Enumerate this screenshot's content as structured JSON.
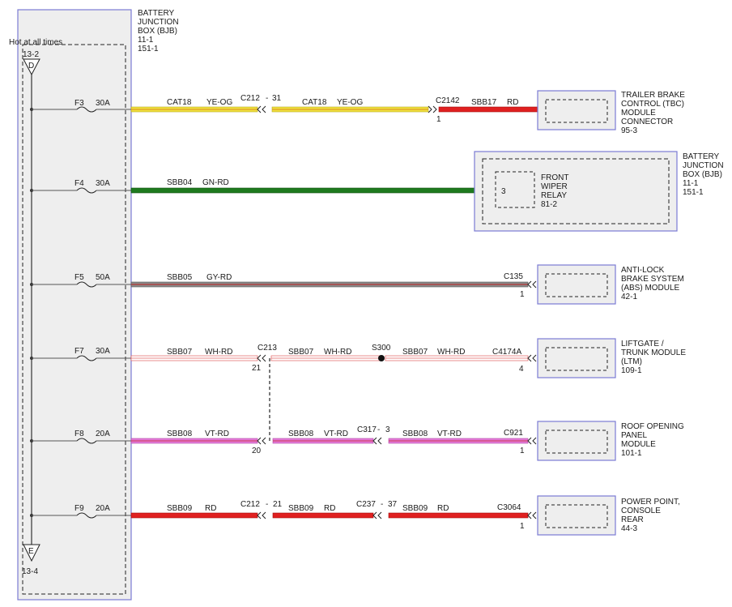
{
  "bjb_left": {
    "lines": [
      "BATTERY",
      "JUNCTION",
      "BOX (BJB)",
      "11-1",
      "151-1"
    ]
  },
  "hot_label": "Hot at all times",
  "top_connector": {
    "ref": "13-2",
    "letter": "D"
  },
  "bottom_connector": {
    "ref": "13-4",
    "letter": "E"
  },
  "circuits": [
    {
      "fuse": "F3",
      "amps": "30A",
      "segments": [
        {
          "circuit": "CAT18",
          "color": "YE-OG",
          "fill": "#f0e03c",
          "stripe": "#d98a24"
        },
        {
          "circuit": "CAT18",
          "color": "YE-OG",
          "fill": "#f0e03c",
          "stripe": "#d98a24"
        },
        {
          "circuit": "SBB17",
          "color": "RD",
          "fill": "#e02020",
          "stripe": ""
        }
      ],
      "breaks": [
        {
          "name": "C212",
          "sep": "-",
          "pin": "31"
        }
      ],
      "end_connector": "C2142",
      "end_pin": "1",
      "module": [
        "TRAILER BRAKE",
        "CONTROL (TBC)",
        "MODULE",
        "CONNECTOR",
        "95-3"
      ]
    },
    {
      "fuse": "F4",
      "amps": "30A",
      "segments": [
        {
          "circuit": "SBB04",
          "color": "GN-RD",
          "fill": "#1e7a1e",
          "stripe": "#c02020"
        }
      ],
      "relay": {
        "lines": [
          "FRONT",
          "WIPER",
          "RELAY",
          "81-2"
        ],
        "pin": "3"
      },
      "module": [
        "BATTERY",
        "JUNCTION",
        "BOX (BJB)",
        "11-1",
        "151-1"
      ]
    },
    {
      "fuse": "F5",
      "amps": "50A",
      "segments": [
        {
          "circuit": "SBB05",
          "color": "GY-RD",
          "fill": "#8a8a8a",
          "stripe": "#c02020"
        }
      ],
      "end_connector": "C135",
      "end_pin": "1",
      "module": [
        "ANTI-LOCK",
        "BRAKE SYSTEM",
        "(ABS) MODULE",
        "42-1"
      ]
    },
    {
      "fuse": "F7",
      "amps": "30A",
      "segments": [
        {
          "circuit": "SBB07",
          "color": "WH-RD",
          "fill": "#ffffff",
          "stripe": "#e06060"
        },
        {
          "circuit": "SBB07",
          "color": "WH-RD",
          "fill": "#ffffff",
          "stripe": "#e06060"
        },
        {
          "circuit": "SBB07",
          "color": "WH-RD",
          "fill": "#ffffff",
          "stripe": "#e06060"
        }
      ],
      "splice_connector": "C213",
      "splice_pin": "21",
      "splice": "S300",
      "end_connector": "C4174A",
      "end_pin": "4",
      "module": [
        "LIFTGATE /",
        "TRUNK MODULE",
        "(LTM)",
        "109-1"
      ]
    },
    {
      "fuse": "F8",
      "amps": "20A",
      "segments": [
        {
          "circuit": "SBB08",
          "color": "VT-RD",
          "fill": "#e37ad8",
          "stripe": "#c02020"
        },
        {
          "circuit": "SBB08",
          "color": "VT-RD",
          "fill": "#e37ad8",
          "stripe": "#c02020"
        },
        {
          "circuit": "SBB08",
          "color": "VT-RD",
          "fill": "#e37ad8",
          "stripe": "#c02020"
        }
      ],
      "splice_pin": "20",
      "breaks": [
        {
          "name": "C317",
          "sep": "-",
          "pin": "3"
        }
      ],
      "end_connector": "C921",
      "end_pin": "1",
      "module": [
        "ROOF OPENING",
        "PANEL",
        "MODULE",
        "101-1"
      ]
    },
    {
      "fuse": "F9",
      "amps": "20A",
      "segments": [
        {
          "circuit": "SBB09",
          "color": "RD",
          "fill": "#e02020",
          "stripe": ""
        },
        {
          "circuit": "SBB09",
          "color": "RD",
          "fill": "#e02020",
          "stripe": ""
        },
        {
          "circuit": "SBB09",
          "color": "RD",
          "fill": "#e02020",
          "stripe": ""
        }
      ],
      "breaks": [
        {
          "name": "C212",
          "sep": "-",
          "pin": "21"
        },
        {
          "name": "C237",
          "sep": "-",
          "pin": "37"
        }
      ],
      "end_connector": "C3064",
      "end_pin": "1",
      "module": [
        "POWER POINT,",
        "CONSOLE",
        "REAR",
        "44-3"
      ]
    }
  ]
}
